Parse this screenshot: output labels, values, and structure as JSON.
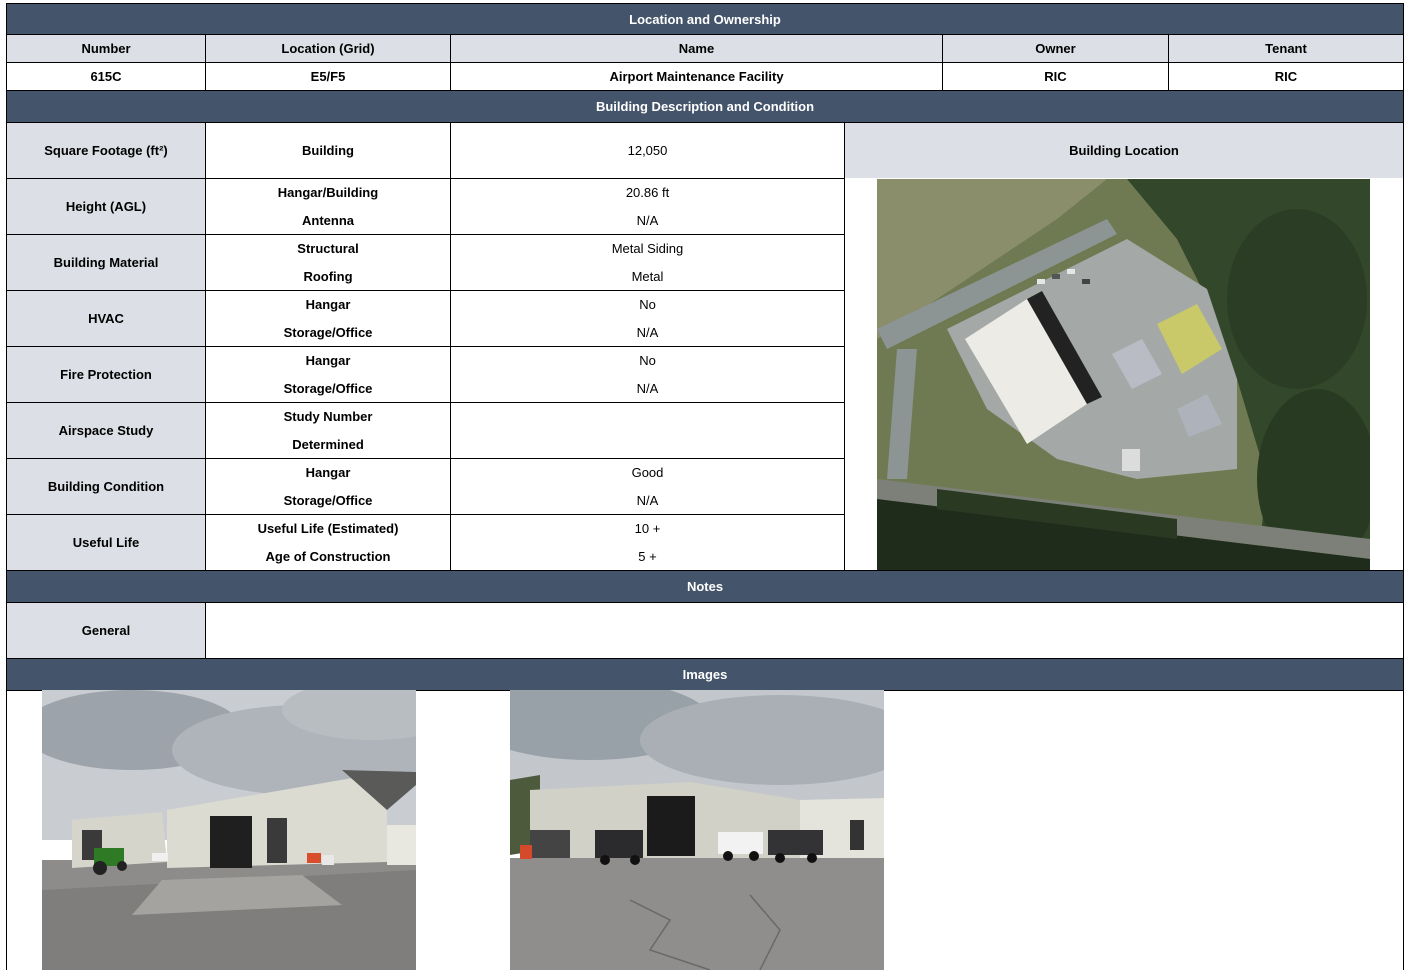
{
  "location_ownership": {
    "title": "Location and Ownership",
    "headers": [
      "Number",
      "Location (Grid)",
      "Name",
      "Owner",
      "Tenant"
    ],
    "values": [
      "615C",
      "E5/F5",
      "Airport Maintenance Facility",
      "RIC",
      "RIC"
    ]
  },
  "building_description": {
    "title": "Building Description and Condition",
    "square_footage": {
      "label": "Square Footage (ft²)",
      "sub": "Building",
      "value": "12,050"
    },
    "building_location_label": "Building Location",
    "groups": [
      {
        "label": "Height (AGL)",
        "rows": [
          {
            "sub": "Hangar/Building",
            "value": "20.86 ft"
          },
          {
            "sub": "Antenna",
            "value": "N/A"
          }
        ]
      },
      {
        "label": "Building Material",
        "rows": [
          {
            "sub": "Structural",
            "value": "Metal Siding"
          },
          {
            "sub": "Roofing",
            "value": "Metal"
          }
        ]
      },
      {
        "label": "HVAC",
        "rows": [
          {
            "sub": "Hangar",
            "value": "No"
          },
          {
            "sub": "Storage/Office",
            "value": "N/A"
          }
        ]
      },
      {
        "label": "Fire Protection",
        "rows": [
          {
            "sub": "Hangar",
            "value": "No"
          },
          {
            "sub": "Storage/Office",
            "value": "N/A"
          }
        ]
      },
      {
        "label": "Airspace Study",
        "rows": [
          {
            "sub": "Study Number",
            "value": ""
          },
          {
            "sub": "Determined",
            "value": ""
          }
        ]
      },
      {
        "label": "Building Condition",
        "rows": [
          {
            "sub": "Hangar",
            "value": "Good"
          },
          {
            "sub": "Storage/Office",
            "value": "N/A"
          }
        ]
      },
      {
        "label": "Useful Life",
        "rows": [
          {
            "sub": "Useful Life (Estimated)",
            "value": "10 +"
          },
          {
            "sub": "Age of Construction",
            "value": "5 +"
          }
        ]
      }
    ]
  },
  "notes": {
    "title": "Notes",
    "general_label": "General",
    "general_value": ""
  },
  "images": {
    "title": "Images"
  },
  "colors": {
    "band": "#44546a",
    "header_fill": "#dcdfe6"
  }
}
